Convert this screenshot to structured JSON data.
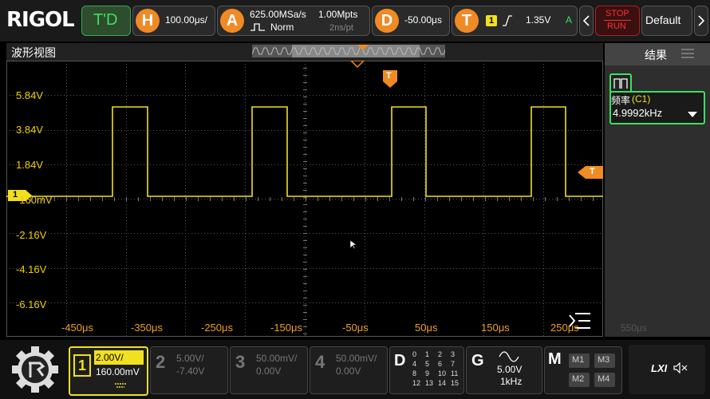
{
  "top": {
    "brand": "RIGOL",
    "mode": "T'D",
    "h_letter": "H",
    "timebase": "100.00μs/",
    "a_letter": "A",
    "sample_rate": "625.00MSa/s",
    "mem_depth": "1.00Mpts",
    "acq_mode": "Norm",
    "sample_interval": "2ns/pt",
    "d_letter": "D",
    "delay": "-50.00μs",
    "t_letter": "T",
    "trig_source": "1",
    "trig_level": "1.35V",
    "trig_status": "A",
    "stop_label": "STOP",
    "run_label": "RUN",
    "default_label": "Default",
    "back_icon": "chevron-left-icon",
    "fwd_icon": "chevron-right-icon"
  },
  "wave": {
    "title": "波形视图",
    "ch1_marker": "1",
    "trig_marker": "T",
    "y_labels": [
      "5.84V",
      "3.84V",
      "1.84V",
      "-160mV",
      "-2.16V",
      "-4.16V",
      "-6.16V"
    ],
    "x_labels": [
      "-450μs",
      "-350μs",
      "-250μs",
      "-150μs",
      "-50μs",
      "50μs",
      "150μs",
      "250μs"
    ],
    "trace_color": "#f0e020"
  },
  "results": {
    "title": "结果",
    "label": "频率",
    "channel": "(C1)",
    "value": "4.9992kHz",
    "ghost_label": "550μs"
  },
  "bottom": {
    "channels": [
      {
        "num": "1",
        "scale": "2.00V/",
        "offset": "160.00mV"
      },
      {
        "num": "2",
        "scale": "5.00V/",
        "offset": "-7.40V"
      },
      {
        "num": "3",
        "scale": "50.00mV/",
        "offset": "0.00V"
      },
      {
        "num": "4",
        "scale": "50.00mV/",
        "offset": "0.00V"
      }
    ],
    "digital": {
      "letter": "D",
      "rows": [
        [
          "0",
          "1",
          "2",
          "3"
        ],
        [
          "4",
          "5",
          "6",
          "7"
        ],
        [
          "8",
          "9",
          "10",
          "11"
        ],
        [
          "12",
          "13",
          "14",
          "15"
        ]
      ]
    },
    "generator": {
      "letter": "G",
      "amplitude": "5.00V",
      "frequency": "1kHz"
    },
    "math": {
      "letter": "M",
      "items": [
        "M1",
        "M3",
        "M2",
        "M4"
      ]
    },
    "lxi": "LXI"
  }
}
